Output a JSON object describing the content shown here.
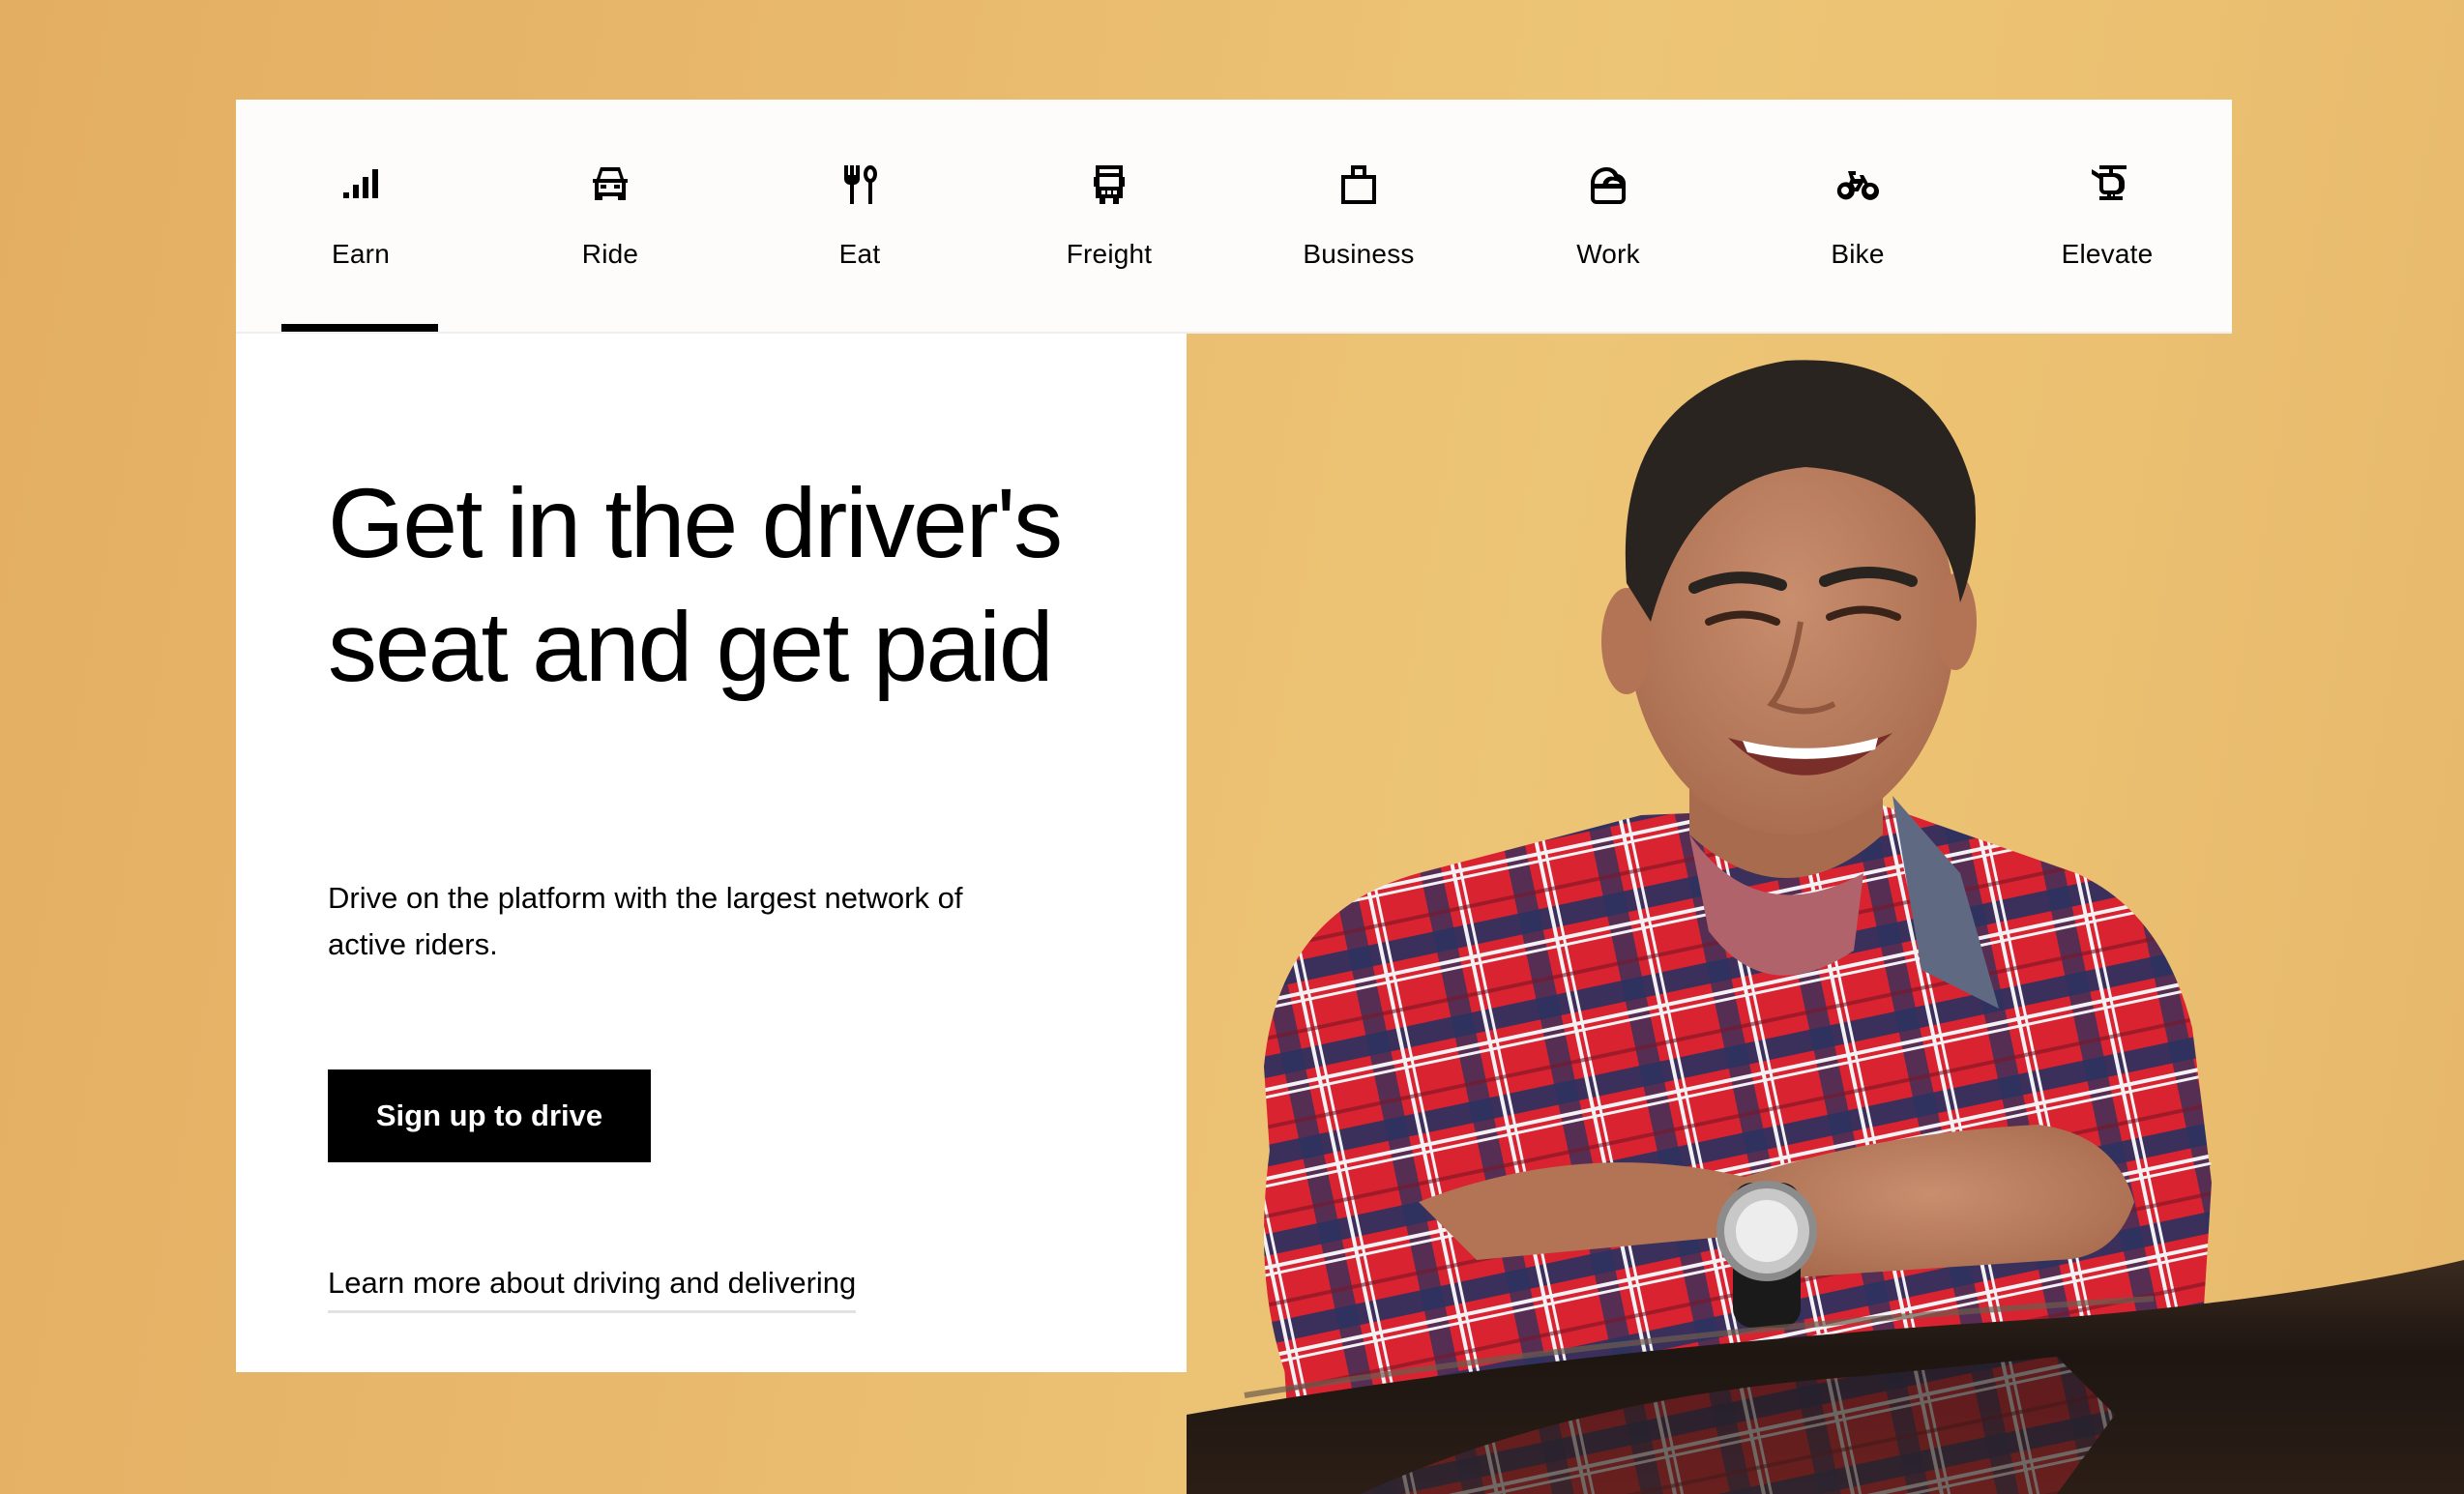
{
  "nav": {
    "tabs": [
      {
        "label": "Earn",
        "icon": "earn-bars-icon",
        "active": true
      },
      {
        "label": "Ride",
        "icon": "car-icon",
        "active": false
      },
      {
        "label": "Eat",
        "icon": "fork-spoon-icon",
        "active": false
      },
      {
        "label": "Freight",
        "icon": "truck-icon",
        "active": false
      },
      {
        "label": "Business",
        "icon": "briefcase-icon",
        "active": false
      },
      {
        "label": "Work",
        "icon": "basket-icon",
        "active": false
      },
      {
        "label": "Bike",
        "icon": "bike-icon",
        "active": false
      },
      {
        "label": "Elevate",
        "icon": "helicopter-icon",
        "active": false
      }
    ]
  },
  "hero": {
    "headline": "Get in the driver's seat and get paid",
    "subtext": "Drive on the platform with the largest network of active riders.",
    "cta_label": "Sign up to drive",
    "link_label": "Learn more about driving and delivering",
    "image_alt": "Smiling man in a red and navy plaid shirt leaning on a car roof"
  },
  "colors": {
    "background": "#E8B86C",
    "accent": "#000000",
    "tabbar_bg": "#FDFCFA",
    "card_bg": "#FFFFFF",
    "link_underline": "#E2E2E2"
  }
}
